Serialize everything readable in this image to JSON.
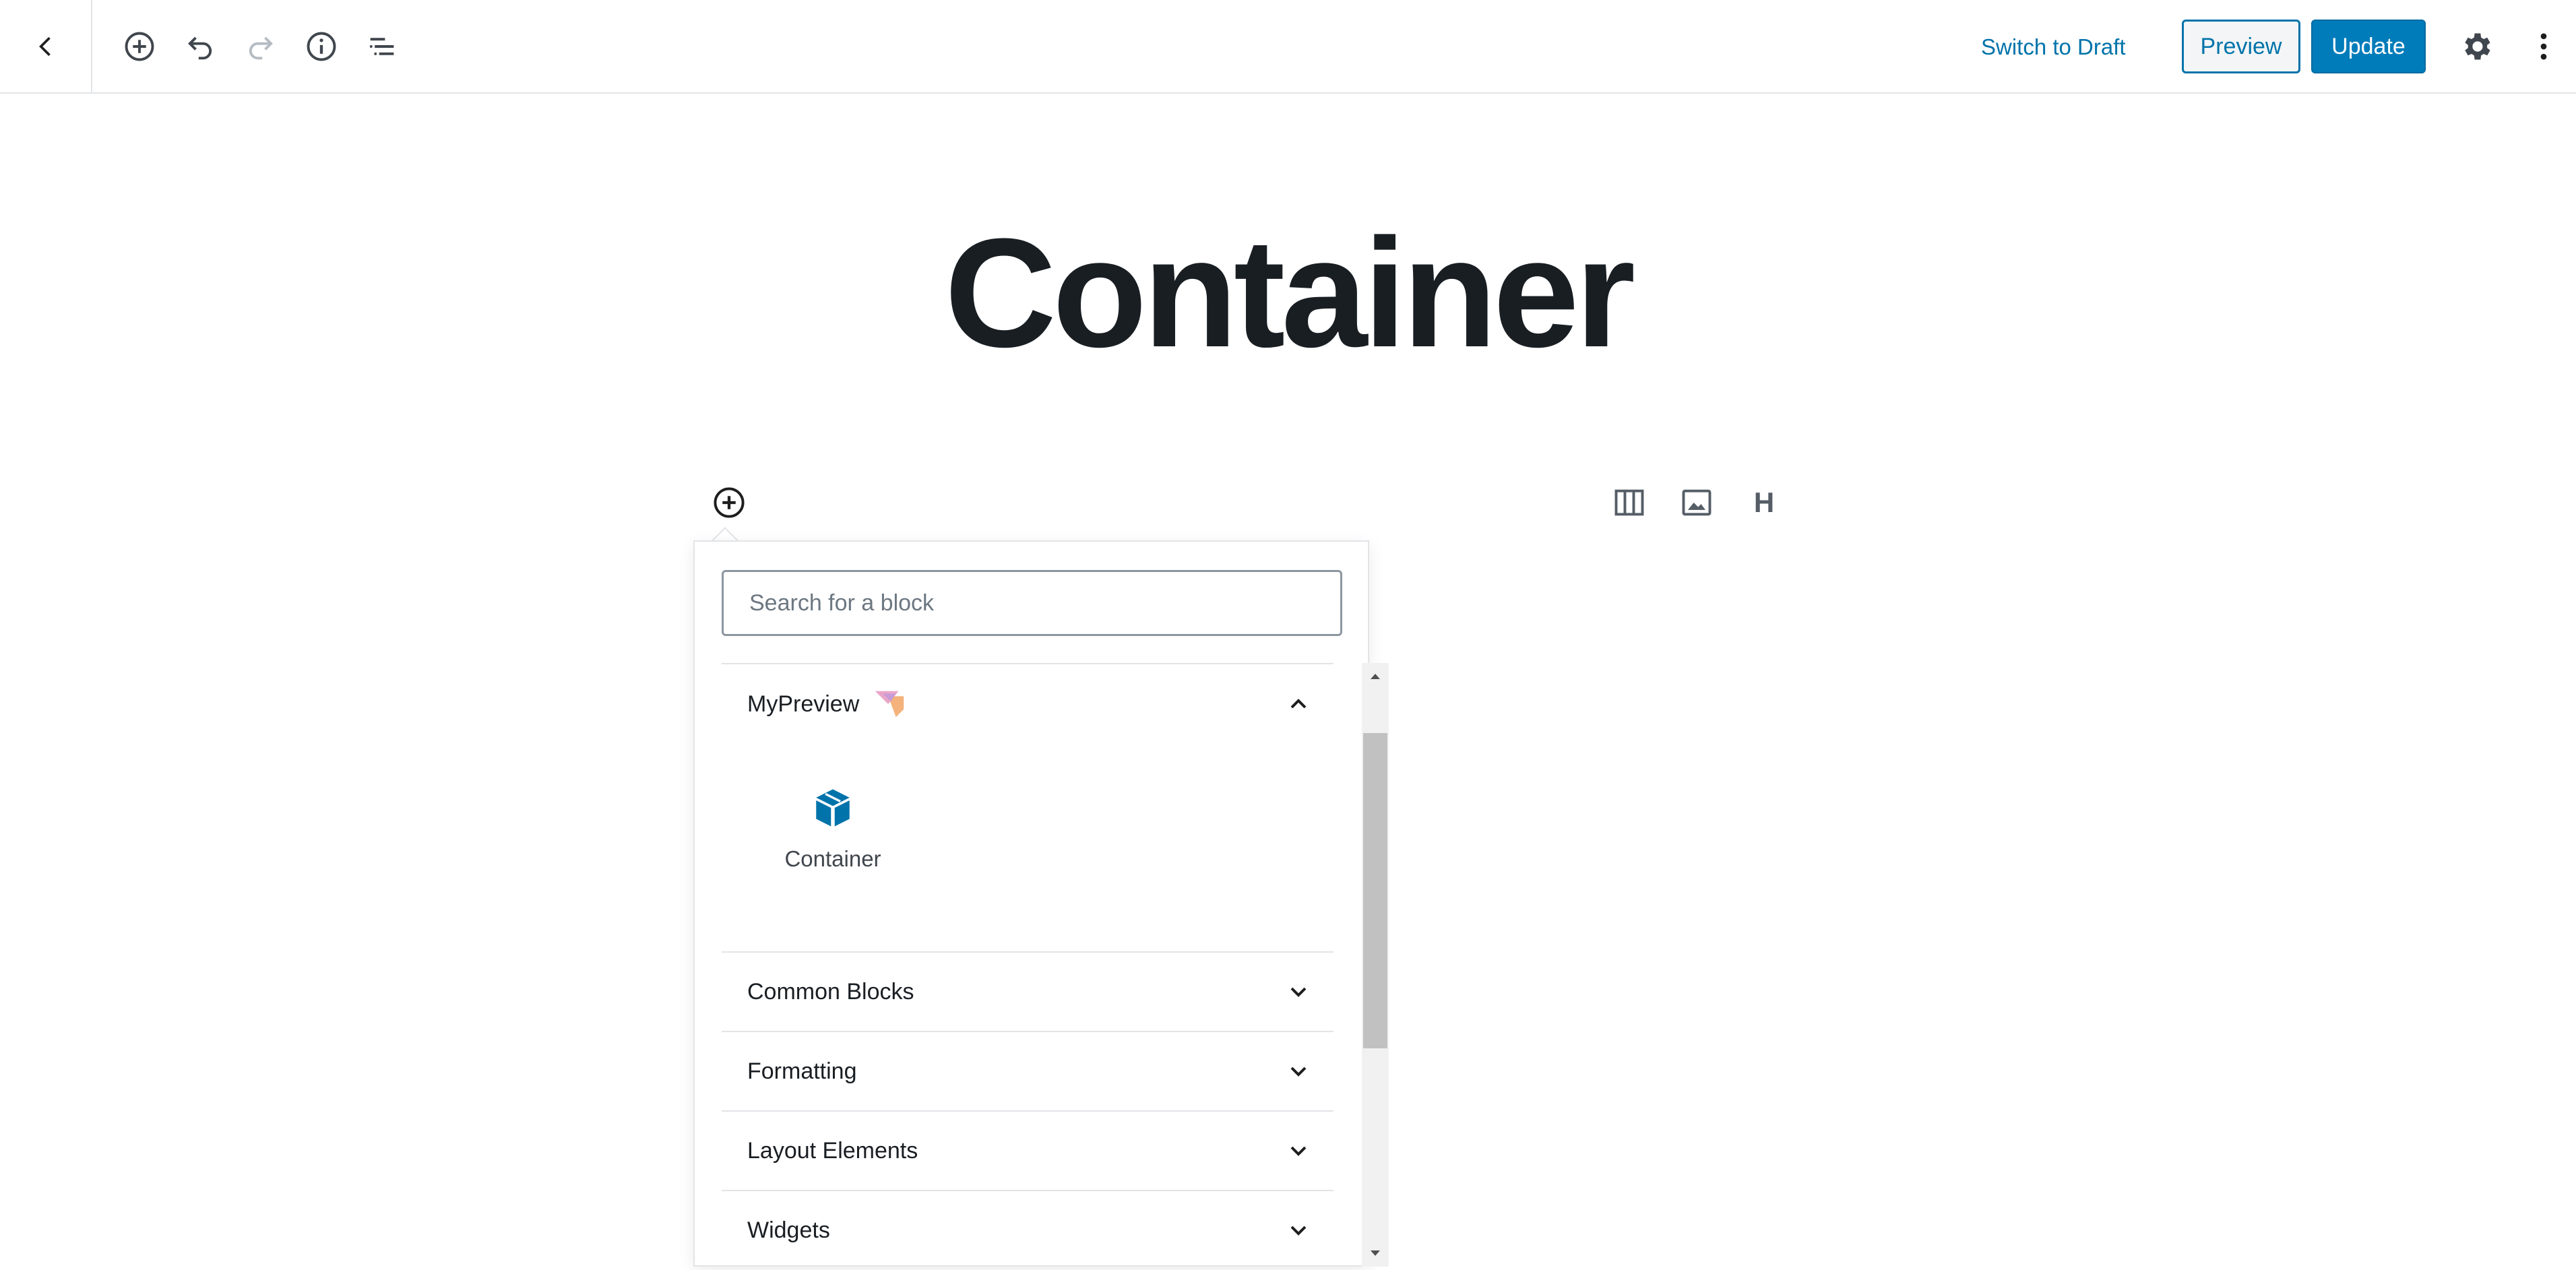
{
  "toolbar": {
    "back_icon": "chevron-left-icon",
    "add_icon": "plus-circle-icon",
    "undo_icon": "undo-icon",
    "redo_icon": "redo-icon",
    "info_icon": "info-icon",
    "outline_icon": "list-outline-icon",
    "switch_to_draft_label": "Switch to Draft",
    "preview_label": "Preview",
    "update_label": "Update",
    "settings_icon": "gear-icon",
    "more_icon": "vertical-ellipsis-icon",
    "accent_color": "#007cba"
  },
  "post": {
    "title": "Container"
  },
  "quick_blocks": [
    {
      "icon": "columns-icon"
    },
    {
      "icon": "image-icon"
    },
    {
      "icon": "heading-icon",
      "glyph": "H"
    }
  ],
  "inserter": {
    "search_placeholder": "Search for a block",
    "panels": [
      {
        "label": "MyPreview",
        "open": true,
        "items": [
          {
            "label": "Container",
            "icon": "box-icon"
          }
        ]
      },
      {
        "label": "Common Blocks",
        "open": false
      },
      {
        "label": "Formatting",
        "open": false
      },
      {
        "label": "Layout Elements",
        "open": false
      },
      {
        "label": "Widgets",
        "open": false
      }
    ]
  }
}
